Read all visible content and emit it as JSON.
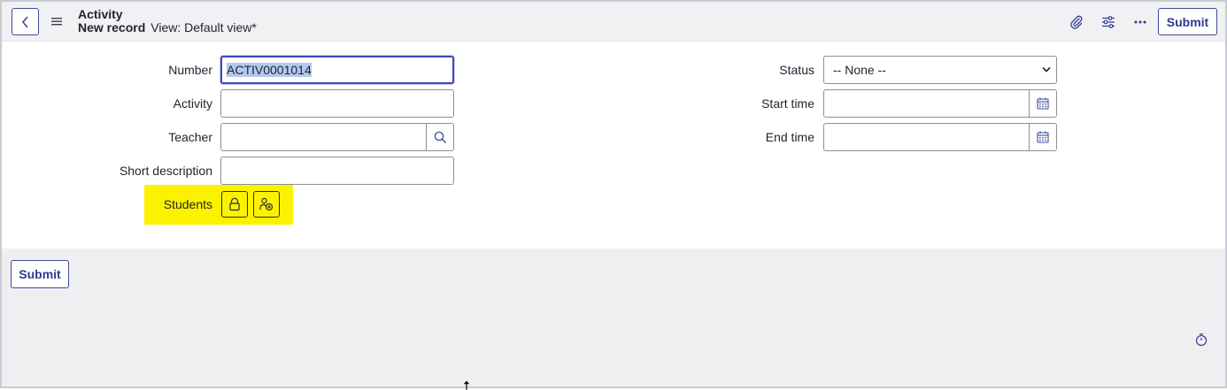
{
  "header": {
    "title": "Activity",
    "record_label": "New record",
    "view_label": "View: Default view*",
    "submit_label": "Submit",
    "icons": [
      "back-icon",
      "menu-icon",
      "attachment-icon",
      "settings-sliders-icon",
      "more-icon"
    ]
  },
  "form": {
    "number": {
      "label": "Number",
      "value": "ACTIV0001014"
    },
    "activity": {
      "label": "Activity",
      "value": ""
    },
    "teacher": {
      "label": "Teacher",
      "value": ""
    },
    "short_description": {
      "label": "Short description",
      "value": ""
    },
    "students": {
      "label": "Students"
    },
    "status": {
      "label": "Status",
      "value": "-- None --"
    },
    "start_time": {
      "label": "Start time",
      "value": ""
    },
    "end_time": {
      "label": "End time",
      "value": ""
    }
  },
  "footer": {
    "submit_label": "Submit"
  },
  "colors": {
    "accent": "#3d4a9c",
    "highlight": "#fbf200",
    "selection": "#b4c9ee",
    "header_bg": "#f1f1f3"
  }
}
